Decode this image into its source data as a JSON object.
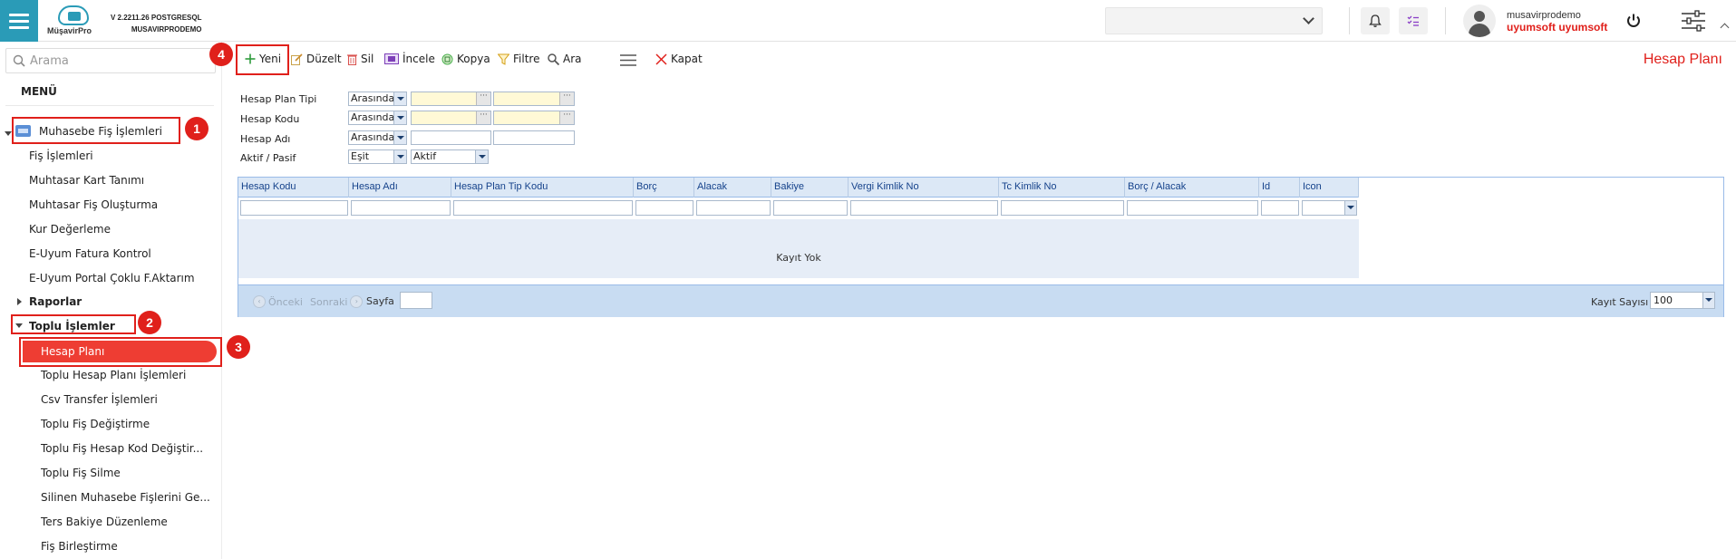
{
  "app": {
    "brand": "MüşavirPro",
    "version": "V 2.2211.26 POSTGRESQL",
    "db": "MUSAVIRPRODEMO"
  },
  "user": {
    "name": "musavirprodemo",
    "company": "uyumsoft uyumsoft"
  },
  "sidebar": {
    "search_placeholder": "Arama",
    "menu_title": "MENÜ",
    "items": [
      {
        "label": "Muhasebe Fiş İşlemleri"
      },
      {
        "label": "Fiş İşlemleri"
      },
      {
        "label": "Muhtasar Kart Tanımı"
      },
      {
        "label": "Muhtasar Fiş Oluşturma"
      },
      {
        "label": "Kur Değerleme"
      },
      {
        "label": "E-Uyum Fatura Kontrol"
      },
      {
        "label": "E-Uyum Portal Çoklu F.Aktarım"
      },
      {
        "label": "Raporlar"
      },
      {
        "label": "Toplu İşlemler"
      },
      {
        "label": "Hesap Planı"
      },
      {
        "label": "Toplu Hesap Planı İşlemleri"
      },
      {
        "label": "Csv Transfer İşlemleri"
      },
      {
        "label": "Toplu Fiş Değiştirme"
      },
      {
        "label": "Toplu Fiş Hesap Kod Değiştir..."
      },
      {
        "label": "Toplu Fiş Silme"
      },
      {
        "label": "Silinen Muhasebe Fişlerini Ge..."
      },
      {
        "label": "Ters Bakiye Düzenleme"
      },
      {
        "label": "Fiş Birleştirme"
      }
    ]
  },
  "annotations": [
    "1",
    "2",
    "3",
    "4"
  ],
  "toolbar": {
    "new": "Yeni",
    "edit": "Düzelt",
    "delete": "Sil",
    "inspect": "İncele",
    "copy": "Kopya",
    "filter": "Filtre",
    "search": "Ara",
    "close": "Kapat",
    "page_title": "Hesap Planı"
  },
  "filters": [
    {
      "label": "Hesap Plan Tipi",
      "operator": "Arasında"
    },
    {
      "label": "Hesap Kodu",
      "operator": "Arasında"
    },
    {
      "label": "Hesap Adı",
      "operator": "Arasında"
    },
    {
      "label": "Aktif / Pasif",
      "operator": "Eşit",
      "value": "Aktif"
    }
  ],
  "grid": {
    "columns": [
      "Hesap Kodu",
      "Hesap Adı",
      "Hesap Plan Tip Kodu",
      "Borç",
      "Alacak",
      "Bakiye",
      "Vergi Kimlik No",
      "Tc Kimlik No",
      "Borç / Alacak",
      "Id",
      "Icon"
    ],
    "empty_text": "Kayıt Yok",
    "pager": {
      "prev": "Önceki",
      "next": "Sonraki",
      "page_label": "Sayfa",
      "page_size_label": "Kayıt Sayısı",
      "page_size": "100"
    }
  },
  "colors": {
    "accent": "#2a9bb7",
    "brand_red": "#e0201b",
    "active_item": "#ee3d33"
  }
}
